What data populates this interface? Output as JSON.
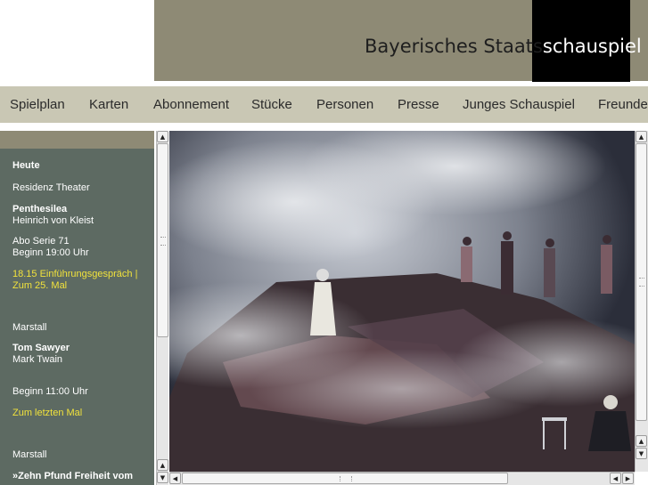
{
  "header": {
    "logo_part1": "Bayerisches Staats",
    "logo_part2": "schauspiel"
  },
  "nav": {
    "items": [
      {
        "label": "Spielplan"
      },
      {
        "label": "Karten"
      },
      {
        "label": "Abonnement"
      },
      {
        "label": "Stücke"
      },
      {
        "label": "Personen"
      },
      {
        "label": "Presse"
      },
      {
        "label": "Junges Schauspiel"
      },
      {
        "label": "Freunde"
      }
    ]
  },
  "sidebar": {
    "heading": "Heute",
    "events": [
      {
        "venue": "Residenz Theater",
        "title": "Penthesilea",
        "author": "Heinrich von Kleist",
        "info1": "Abo Serie 71",
        "info2": "Beginn 19:00 Uhr",
        "link1": "18.15 Einführungsgespräch |",
        "link2": "Zum 25. Mal"
      },
      {
        "venue": "Marstall",
        "title": "Tom Sawyer",
        "author": "Mark Twain",
        "info1": "Beginn 11:00 Uhr",
        "link1": "Zum letzten Mal"
      },
      {
        "venue": "Marstall",
        "title": "»Zehn Pfund Freiheit vom"
      }
    ]
  },
  "colors": {
    "banner": "#8e8a75",
    "nav_bg": "#c9c7b4",
    "sidebar_bg": "#5d6a62",
    "link_yellow": "#f1e23c"
  }
}
